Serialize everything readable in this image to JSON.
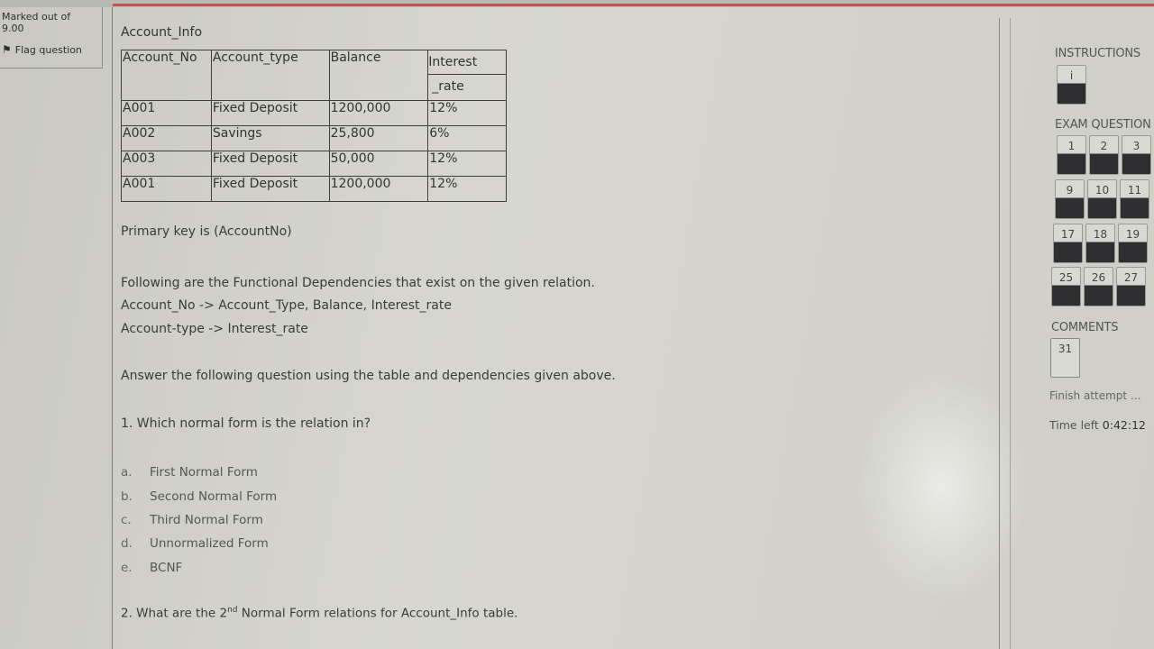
{
  "info": {
    "marked_label": "Marked out of",
    "marked_value": "9.00",
    "flag_label": "Flag question"
  },
  "question": {
    "table_title": "Account_Info",
    "headers": [
      "Account_No",
      "Account_type",
      "Balance",
      "Interest",
      "_rate"
    ],
    "rows": [
      [
        "A001",
        "Fixed Deposit",
        "1200,000",
        "12%"
      ],
      [
        "A002",
        "Savings",
        "25,800",
        "6%"
      ],
      [
        "A003",
        "Fixed Deposit",
        "50,000",
        "12%"
      ],
      [
        "A001",
        "Fixed Deposit",
        "1200,000",
        "12%"
      ]
    ],
    "primary_key": "Primary key is (AccountNo)",
    "fd_intro": "Following are the Functional Dependencies that exist on the given relation.",
    "fd1": "Account_No -> Account_Type, Balance, Interest_rate",
    "fd2": "Account-type -> Interest_rate",
    "instruction": "Answer the following question using the table and dependencies given above.",
    "q1": "1. Which normal form is the relation in?",
    "options": [
      {
        "letter": "a.",
        "text": "First Normal Form"
      },
      {
        "letter": "b.",
        "text": "Second Normal Form"
      },
      {
        "letter": "c.",
        "text": "Third Normal Form"
      },
      {
        "letter": "d.",
        "text": "Unnormalized Form"
      },
      {
        "letter": "e.",
        "text": "BCNF"
      }
    ],
    "q2_before": "2. What are the 2",
    "q2_sup": "nd",
    "q2_after": " Normal Form relations for Account_Info table."
  },
  "sidebar": {
    "instructions_label": "INSTRUCTIONS",
    "instructions_btn": "i",
    "exam_label": "EXAM QUESTION",
    "questions": [
      "1",
      "2",
      "3",
      "9",
      "10",
      "11",
      "17",
      "18",
      "19",
      "25",
      "26",
      "27"
    ],
    "comments_label": "COMMENTS",
    "comment_btn": "31",
    "finish_label": "Finish attempt ...",
    "time_label": "Time left",
    "time_value": "0:42:12"
  }
}
